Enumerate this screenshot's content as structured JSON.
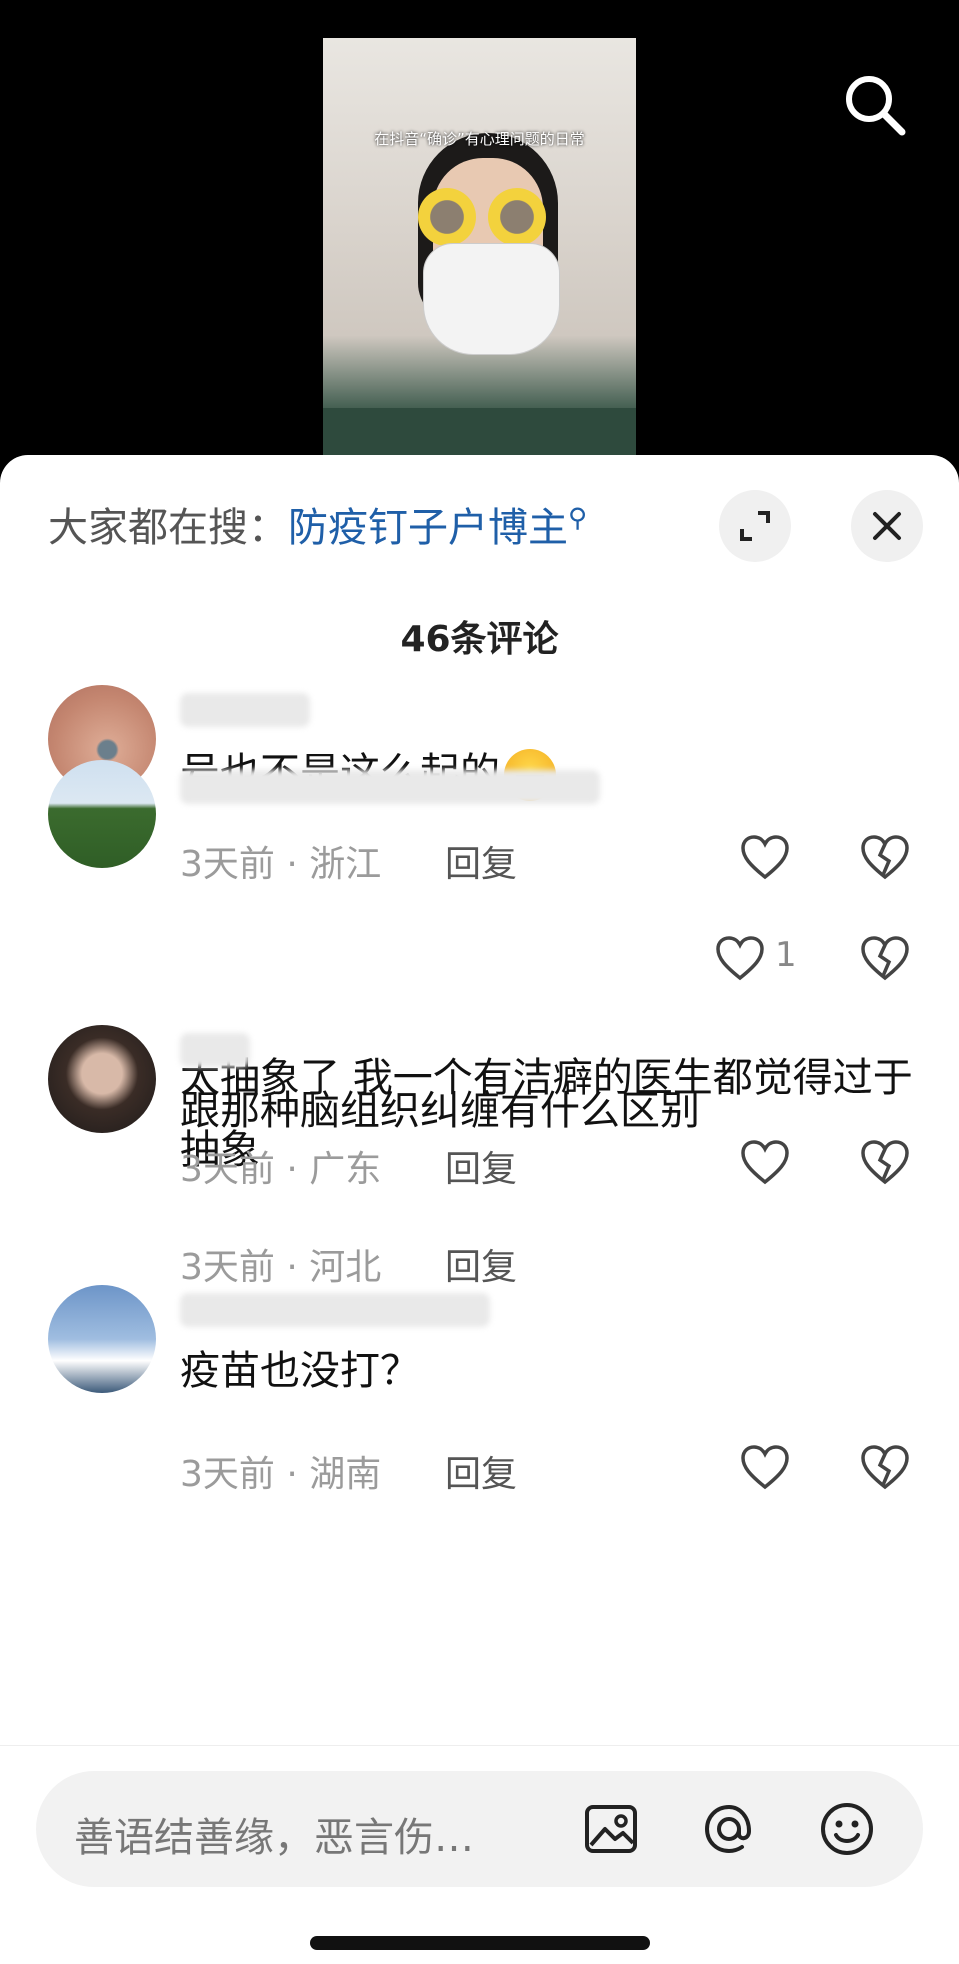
{
  "video": {
    "caption": "在抖音“确诊”有心理问题的日常"
  },
  "header": {
    "hot_search_label": "大家都在搜：",
    "hot_search_term": "防疫钉子户博主",
    "comment_count": "46条评论"
  },
  "comments": [
    {
      "text": "号也不是这么起的",
      "has_emoji": true,
      "time_location": "3天前 · 浙江",
      "reply_label": "回复",
      "likes": ""
    },
    {
      "text": "太抽象了  我一个有洁癖的医生都觉得过于抽象",
      "has_emoji": false,
      "time_location": "3天前 · 河北",
      "reply_label": "回复",
      "likes": "1"
    },
    {
      "text": "跟那种脑组织纠缠有什么区别",
      "has_emoji": false,
      "time_location": "3天前 · 广东",
      "reply_label": "回复",
      "likes": ""
    },
    {
      "text": "疫苗也没打？",
      "has_emoji": false,
      "time_location": "3天前 · 湖南",
      "reply_label": "回复",
      "likes": ""
    }
  ],
  "input": {
    "placeholder": "善语结善缘，恶言伤…"
  },
  "icons": {
    "search": "search-icon",
    "expand": "expand-icon",
    "close": "close-icon",
    "like": "heart-icon",
    "dislike": "broken-heart-icon",
    "image": "image-icon",
    "mention": "at-icon",
    "emoji": "emoji-icon"
  }
}
